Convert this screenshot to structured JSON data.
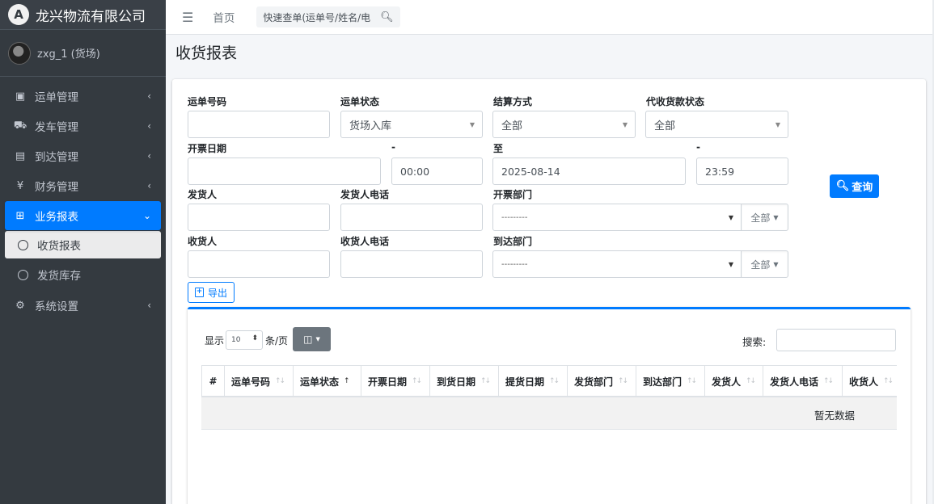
{
  "brand": {
    "logo_letter": "A",
    "name": "龙兴物流有限公司"
  },
  "user": {
    "name": "zxg_1 (货场)"
  },
  "sidebar": {
    "items": [
      {
        "label": "运单管理",
        "icon": "clipboard-icon",
        "glyph": "▣"
      },
      {
        "label": "发车管理",
        "icon": "truck-icon",
        "glyph": "⛟"
      },
      {
        "label": "到达管理",
        "icon": "dolly-icon",
        "glyph": "▤"
      },
      {
        "label": "财务管理",
        "icon": "yen-icon",
        "glyph": "¥"
      },
      {
        "label": "业务报表",
        "icon": "table-icon",
        "glyph": "⊞"
      },
      {
        "label": "收货报表"
      },
      {
        "label": "发货库存"
      },
      {
        "label": "系统设置",
        "icon": "gear-icon",
        "glyph": "⚙"
      }
    ]
  },
  "topbar": {
    "home": "首页",
    "search_placeholder": "快速查单(运单号/姓名/电"
  },
  "page": {
    "title": "收货报表"
  },
  "form": {
    "waybill_no": {
      "label": "运单号码",
      "value": ""
    },
    "waybill_status": {
      "label": "运单状态",
      "value": "货场入库"
    },
    "settlement": {
      "label": "结算方式",
      "value": "全部"
    },
    "cod_status": {
      "label": "代收货款状态",
      "value": "全部"
    },
    "invoice_date": {
      "label": "开票日期",
      "start_date": "",
      "start_time": "00:00",
      "to_label": "至",
      "end_date": "2025-08-14",
      "end_time": "23:59",
      "dash": "-"
    },
    "sender": {
      "label": "发货人",
      "value": ""
    },
    "sender_phone": {
      "label": "发货人电话",
      "value": ""
    },
    "invoice_dept": {
      "label": "开票部门",
      "value": "---------",
      "all": "全部"
    },
    "receiver": {
      "label": "收货人",
      "value": ""
    },
    "receiver_phone": {
      "label": "收货人电话",
      "value": ""
    },
    "arrival_dept": {
      "label": "到达部门",
      "value": "---------",
      "all": "全部"
    },
    "query_button": "查询",
    "export_button": "导出"
  },
  "table": {
    "show_label": "显示",
    "page_length": "10",
    "per_page_label": "条/页",
    "search_label": "搜索:",
    "columns": [
      "#",
      "运单号码",
      "运单状态",
      "开票日期",
      "到货日期",
      "提货日期",
      "发货部门",
      "到达部门",
      "发货人",
      "发货人电话",
      "收货人"
    ],
    "empty_text": "暂无数据"
  },
  "colors": {
    "primary": "#007bff",
    "sidebar_bg": "#343a40",
    "page_bg": "#f4f6f9"
  }
}
